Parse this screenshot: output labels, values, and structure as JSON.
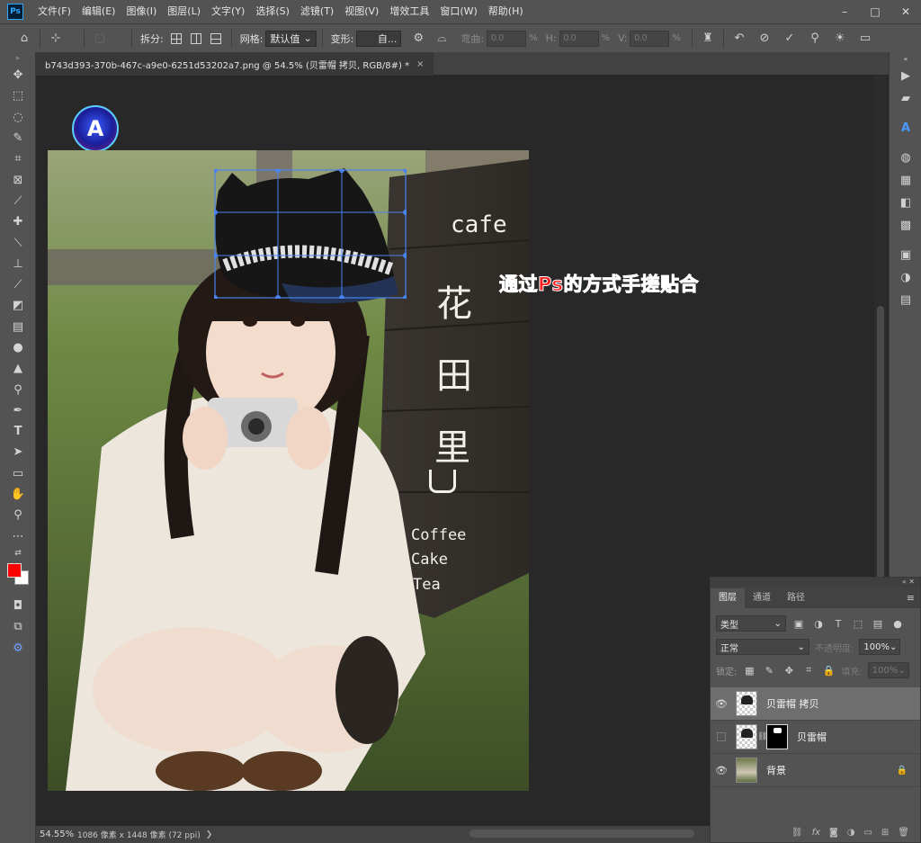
{
  "app": {
    "logo": "Ps",
    "menu": [
      "文件(F)",
      "编辑(E)",
      "图像(I)",
      "图层(L)",
      "文字(Y)",
      "选择(S)",
      "滤镜(T)",
      "视图(V)",
      "增效工具",
      "窗口(W)",
      "帮助(H)"
    ],
    "window_controls": [
      "–",
      "□",
      "✕"
    ]
  },
  "options_bar": {
    "split_label": "拆分:",
    "grid_label": "网格:",
    "grid_value": "默认值",
    "warp_label": "变形:",
    "warp_value": "自...",
    "bend_label": "弯曲:",
    "bend_value": "0.0",
    "h_label": "H:",
    "h_value": "0.0",
    "v_label": "V:",
    "v_value": "0.0",
    "percent": "%"
  },
  "document": {
    "tab_title": "b743d393-370b-467c-a9e0-6251d53202a7.png @ 54.5% (贝雷帽 拷贝, RGB/8#) *",
    "close": "×"
  },
  "canvas": {
    "overlay_text": "通过Ps的方式手搓贴合",
    "watermark_letter": "A",
    "sign_lines": [
      "cafe",
      "花",
      "田",
      "里",
      "Coffee",
      "Cake",
      "Tea"
    ]
  },
  "colors": {
    "foreground": "#ff0000",
    "background": "#ffffff",
    "transform_box": "#4a82f0"
  },
  "layers_panel": {
    "tabs": [
      "图层",
      "通道",
      "路径"
    ],
    "active_tab": 0,
    "filter_label": "类型",
    "blend_mode": "正常",
    "opacity_label": "不透明度:",
    "opacity_value": "100%",
    "lock_label": "锁定:",
    "fill_label": "填充:",
    "fill_value": "100%",
    "layers": [
      {
        "name": "贝雷帽 拷贝",
        "visible": true,
        "selected": true,
        "has_mask": false
      },
      {
        "name": "贝雷帽",
        "visible": false,
        "selected": false,
        "has_mask": true
      },
      {
        "name": "背景",
        "visible": true,
        "selected": false,
        "has_mask": false,
        "locked": true
      }
    ]
  },
  "status_bar": {
    "zoom": "54.55%",
    "info": "1086 像素 x 1448 像素 (72 ppi)",
    "arrow": "❯"
  }
}
